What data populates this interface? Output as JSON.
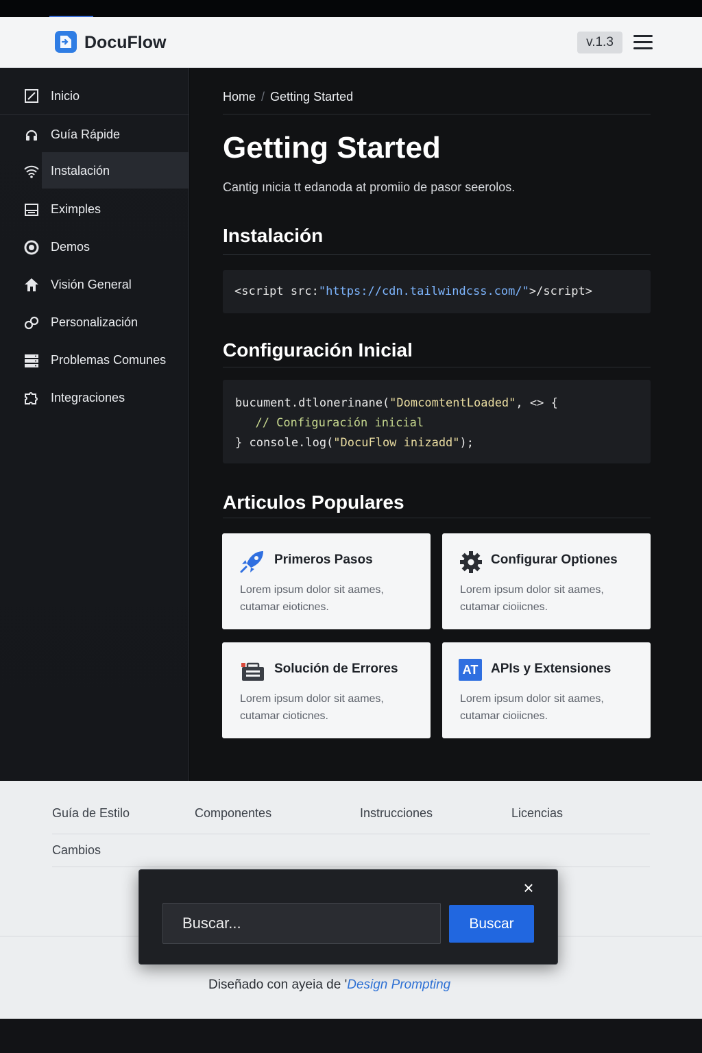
{
  "header": {
    "brand": "DocuFlow",
    "version": "v.1.3",
    "logo_icon": "document-arrow-icon",
    "menu_icon": "hamburger-icon"
  },
  "sidebar": {
    "items": [
      {
        "label": "Inicio",
        "icon": "edit-square-icon"
      },
      {
        "label": "Guía Rápide",
        "icon": "headset-icon"
      },
      {
        "label": "Instalación",
        "icon": "wifi-icon",
        "active": true
      },
      {
        "label": "Eximples",
        "icon": "window-icon"
      },
      {
        "label": "Demos",
        "icon": "ring-icon"
      },
      {
        "label": "Visión General",
        "icon": "house-up-icon"
      },
      {
        "label": "Personalización",
        "icon": "link-icon"
      },
      {
        "label": "Problemas Comunes",
        "icon": "server-icon"
      },
      {
        "label": "Integraciones",
        "icon": "puzzle-icon"
      }
    ]
  },
  "main": {
    "breadcrumb": {
      "home": "Home",
      "separator": "/",
      "current": "Getting Started"
    },
    "title": "Getting Started",
    "lead": "Cantig ınicia tt edanoda at promiio de pasor seerolos.",
    "install": {
      "heading": "Instalación",
      "code_prefix": "<script src:",
      "code_url": "\"https://cdn.tailwindcss.com/\"",
      "code_suffix": ">∕script>"
    },
    "config": {
      "heading": "Configuración Inicial",
      "line1_a": "bucument.dtlonerinane(",
      "line1_str": "\"DomcomtentLoaded\"",
      "line1_b": ", <> {",
      "line2": "  // Configuración inicial",
      "line3_a": "} console.log(",
      "line3_str": "\"DocuFlow inizadd\"",
      "line3_b": ");"
    },
    "popular": {
      "heading": "Articulos Populares",
      "cards": [
        {
          "title": "Primeros Pasos",
          "body": "Lorem ipsum dolor sit aames, cutamar eioticnes.",
          "icon": "rocket-icon"
        },
        {
          "title": "Configurar Optiones",
          "body": "Lorem ipsum dolor sit aames, cutamar cioiicnes.",
          "icon": "gear-icon"
        },
        {
          "title": "Solución de Errores",
          "body": "Lorem ipsum dolor sit aames, cutamar cioticnes.",
          "icon": "toolbox-icon"
        },
        {
          "title": "APIs y Extensiones",
          "body": "Lorem ipsum dolor sit aames, cutamar cioiicnes.",
          "icon": "at-badge-icon",
          "badge": "AT"
        }
      ]
    }
  },
  "footer": {
    "links": [
      "Guía de Estilo",
      "Componentes",
      "Instrucciones",
      "Licencias",
      "Cambios"
    ],
    "credit_prefix": "Diseñado con ayeia de '",
    "credit_link": "Design Prompting"
  },
  "search": {
    "placeholder": "Buscar...",
    "button": "Buscar",
    "close": "×"
  },
  "colors": {
    "accent": "#2167e0",
    "sidebar_bg": "#17191d",
    "main_bg": "#111214",
    "footer_bg": "#eceef0"
  }
}
